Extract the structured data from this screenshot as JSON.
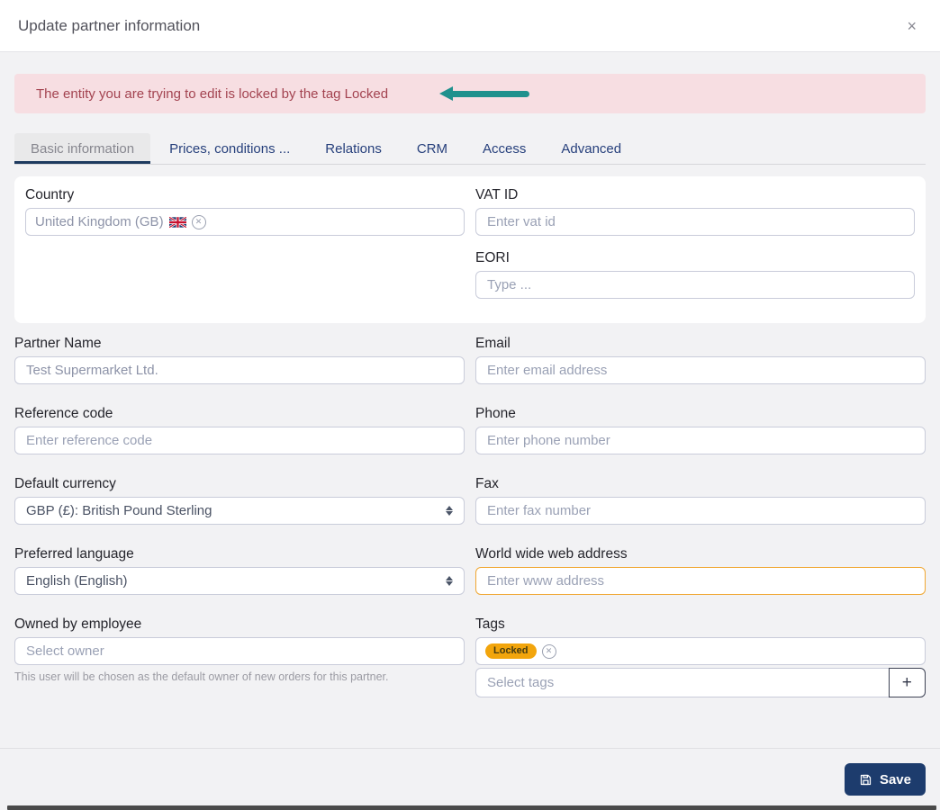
{
  "modal": {
    "title": "Update partner information",
    "close_icon": "×"
  },
  "alert": {
    "text": "The entity you are trying to edit is locked by the tag Locked"
  },
  "tabs": [
    {
      "label": "Basic information",
      "active": true
    },
    {
      "label": "Prices, conditions ...",
      "active": false
    },
    {
      "label": "Relations",
      "active": false
    },
    {
      "label": "CRM",
      "active": false
    },
    {
      "label": "Access",
      "active": false
    },
    {
      "label": "Advanced",
      "active": false
    }
  ],
  "form": {
    "country": {
      "label": "Country",
      "value": "United Kingdom (GB)",
      "flag": "uk-flag",
      "remove_icon": "✕"
    },
    "vat": {
      "label": "VAT ID",
      "placeholder": "Enter vat id"
    },
    "eori": {
      "label": "EORI",
      "placeholder": "Type ..."
    },
    "partner_name": {
      "label": "Partner Name",
      "value": "Test Supermarket Ltd."
    },
    "email": {
      "label": "Email",
      "placeholder": "Enter email address"
    },
    "reference_code": {
      "label": "Reference code",
      "placeholder": "Enter reference code"
    },
    "phone": {
      "label": "Phone",
      "placeholder": "Enter phone number"
    },
    "default_currency": {
      "label": "Default currency",
      "value": "GBP (£): British Pound Sterling"
    },
    "fax": {
      "label": "Fax",
      "placeholder": "Enter fax number"
    },
    "preferred_language": {
      "label": "Preferred language",
      "value": "English (English)"
    },
    "www": {
      "label": "World wide web address",
      "placeholder": "Enter www address"
    },
    "owner": {
      "label": "Owned by employee",
      "placeholder": "Select owner",
      "help": "This user will be chosen as the default owner of new orders for this partner."
    },
    "tags": {
      "label": "Tags",
      "applied_tag": "Locked",
      "remove_icon": "✕",
      "placeholder": "Select tags",
      "add_button": "+"
    }
  },
  "footer": {
    "save_label": "Save"
  },
  "colors": {
    "alert_bg": "#f7dee2",
    "alert_text": "#a34350",
    "arrow_teal": "#1f918d",
    "tab_text": "#27407c",
    "tab_active_underline": "#1e3a5f",
    "input_border": "#c9ccda",
    "www_focus_border": "#f0a732",
    "tag_bg": "#f2a50c",
    "save_button_bg": "#1d3c6d",
    "body_bg": "#f2f2f4"
  }
}
